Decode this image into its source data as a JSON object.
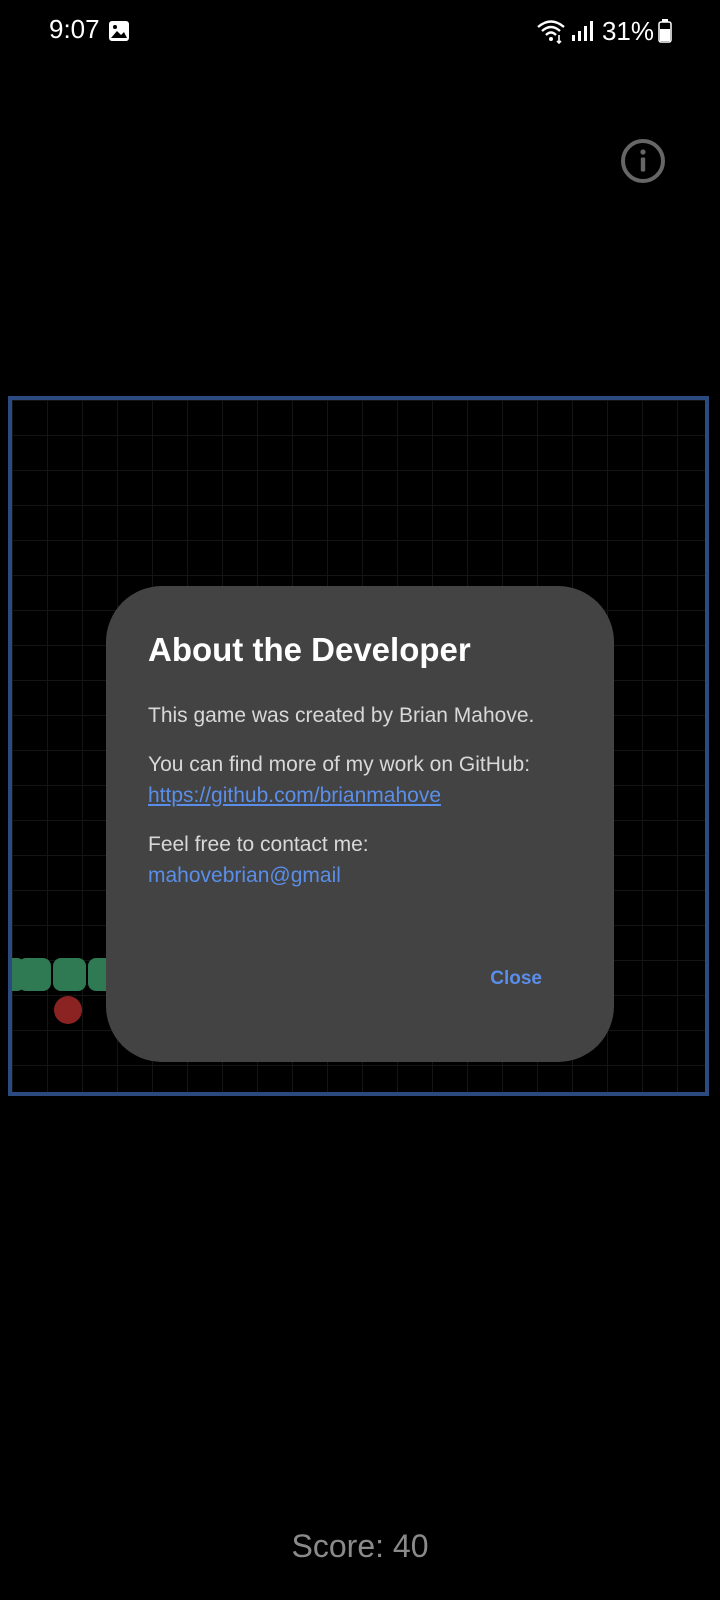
{
  "status_bar": {
    "time": "9:07",
    "battery": "31%",
    "icons": [
      "gallery-icon",
      "wifi-icon",
      "signal-icon",
      "battery-icon"
    ]
  },
  "header": {
    "info_icon": "info-icon"
  },
  "dialog": {
    "title": "About the Developer",
    "line1": "This game was created by Brian Mahove.",
    "line2": "You can find more of my work on GitHub:",
    "github_link": "https://github.com/brianmahove",
    "line3": "Feel free to contact me:",
    "email": "mahovebrian@gmail",
    "close_label": "Close"
  },
  "game": {
    "score_text": "Score: 40",
    "colors": {
      "border": "#2a4a80",
      "snake": "#2f7a52",
      "food": "#8b2323",
      "dialog_bg": "#434343",
      "link": "#5a8ee8"
    }
  }
}
